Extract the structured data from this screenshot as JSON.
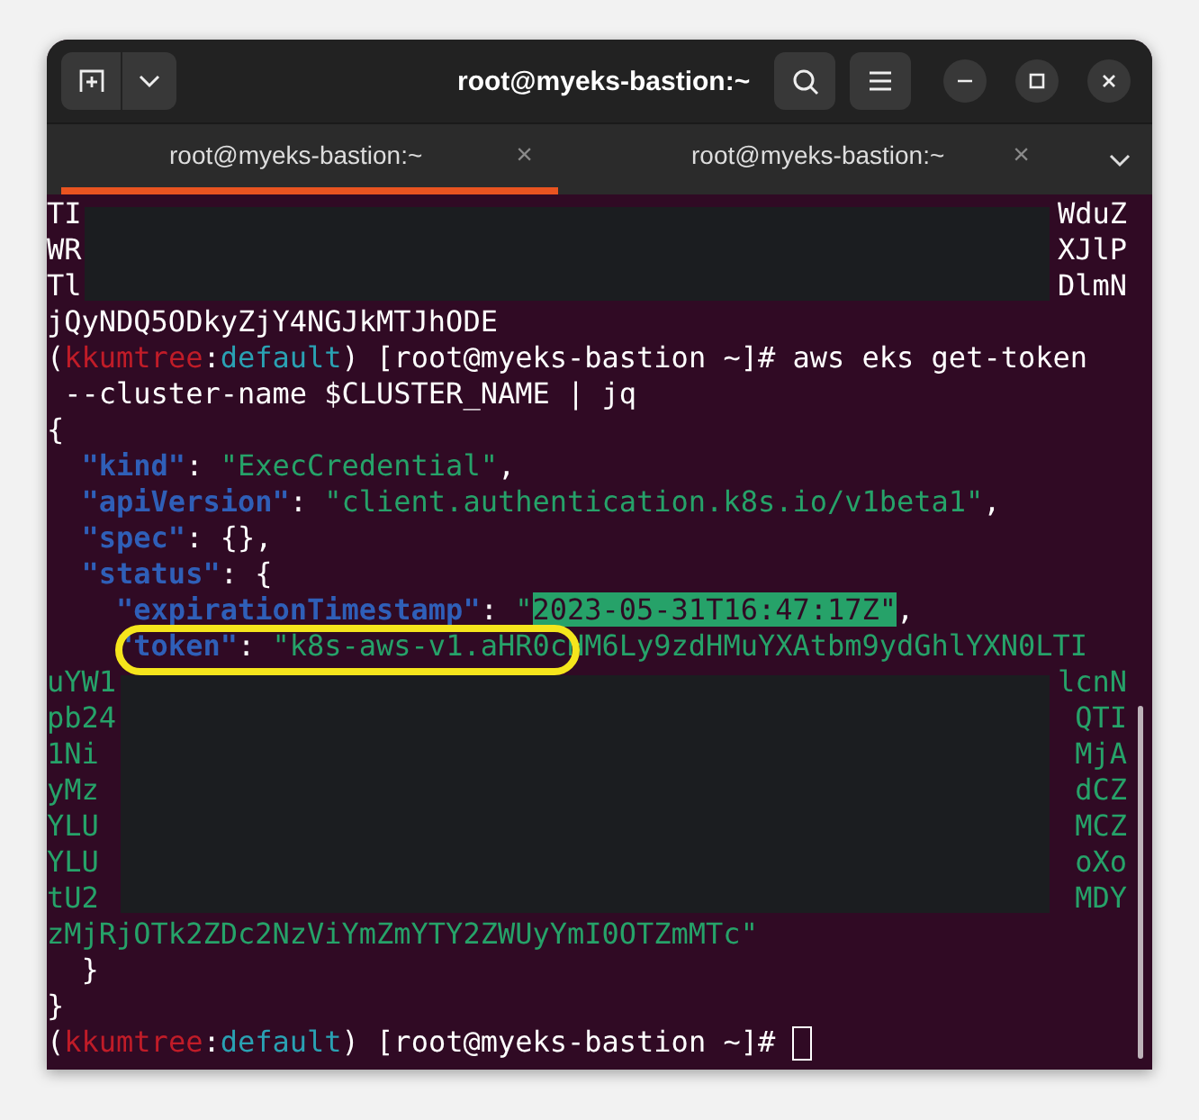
{
  "window": {
    "title": "root@myeks-bastion:~"
  },
  "tabs": [
    {
      "label": "root@myeks-bastion:~",
      "close": "×",
      "selected": true
    },
    {
      "label": "root@myeks-bastion:~",
      "close": "×",
      "selected": false
    }
  ],
  "terminal": {
    "lines": [
      {
        "kind": "masked",
        "rows": [
          {
            "kind": "plain",
            "left": "TI",
            "right": "WduZ"
          },
          {
            "kind": "plain",
            "left": "WR",
            "right": "XJlP"
          },
          {
            "kind": "plain",
            "left": "Tl",
            "right": "DlmN"
          }
        ]
      },
      {
        "kind": "text",
        "segments": [
          {
            "text": "jQyNDQ5ODkyZjY4NGJkMTJhODE",
            "kind": "plain"
          }
        ]
      },
      {
        "kind": "text",
        "segments": [
          {
            "text": "(",
            "kind": "plain"
          },
          {
            "text": "kkumtree",
            "kind": "context"
          },
          {
            "text": ":",
            "kind": "plain"
          },
          {
            "text": "default",
            "kind": "namespace"
          },
          {
            "text": ") [root@myeks-bastion ~]# aws eks get-token",
            "kind": "plain"
          }
        ]
      },
      {
        "kind": "text",
        "segments": [
          {
            "text": " --cluster-name $CLUSTER_NAME | jq",
            "kind": "plain"
          }
        ]
      },
      {
        "kind": "text",
        "segments": [
          {
            "text": "{",
            "kind": "punct"
          }
        ]
      },
      {
        "kind": "text",
        "segments": [
          {
            "text": "  \"kind\"",
            "kind": "key"
          },
          {
            "text": ": ",
            "kind": "punct"
          },
          {
            "text": "\"ExecCredential\"",
            "kind": "string"
          },
          {
            "text": ",",
            "kind": "punct"
          }
        ]
      },
      {
        "kind": "text",
        "segments": [
          {
            "text": "  \"apiVersion\"",
            "kind": "key"
          },
          {
            "text": ": ",
            "kind": "punct"
          },
          {
            "text": "\"client.authentication.k8s.io/v1beta1\"",
            "kind": "string"
          },
          {
            "text": ",",
            "kind": "punct"
          }
        ]
      },
      {
        "kind": "text",
        "segments": [
          {
            "text": "  \"spec\"",
            "kind": "key"
          },
          {
            "text": ": {},",
            "kind": "punct"
          }
        ]
      },
      {
        "kind": "text",
        "segments": [
          {
            "text": "  \"status\"",
            "kind": "key"
          },
          {
            "text": ": {",
            "kind": "punct"
          }
        ]
      },
      {
        "kind": "text",
        "segments": [
          {
            "text": "    \"expirationTimestamp\"",
            "kind": "key"
          },
          {
            "text": ": ",
            "kind": "punct"
          },
          {
            "text": "\"",
            "kind": "string"
          },
          {
            "text": "2023-05-31T16:47:17Z\"",
            "kind": "highlight"
          },
          {
            "text": ",",
            "kind": "punct"
          }
        ]
      },
      {
        "kind": "text",
        "circled": true,
        "segments": [
          {
            "text": "    \"token\"",
            "kind": "key"
          },
          {
            "text": ": ",
            "kind": "punct"
          },
          {
            "text": "\"k8s-aws-v1.aHR0cHM6Ly9zdHMuYXAtbm9ydGhlYXN0LTI",
            "kind": "string"
          }
        ]
      },
      {
        "kind": "masked",
        "rows": [
          {
            "kind": "string",
            "left": "uYW1",
            "right": "lcnN"
          },
          {
            "kind": "string",
            "left": "pb24",
            "right": "QTI"
          },
          {
            "kind": "string",
            "left": "1Ni",
            "right": "MjA"
          },
          {
            "kind": "string",
            "left": "yMz",
            "right": "dCZ"
          },
          {
            "kind": "string",
            "left": "YLU",
            "right": "MCZ"
          },
          {
            "kind": "string",
            "left": "YLU",
            "right": "oXo"
          },
          {
            "kind": "string",
            "left": "tU2",
            "right": "MDY"
          }
        ]
      },
      {
        "kind": "text",
        "segments": [
          {
            "text": "zMjRjOTk2ZDc2NzViYmZmYTY2ZWUyYmI0OTZmMTc\"",
            "kind": "string"
          }
        ]
      },
      {
        "kind": "text",
        "segments": [
          {
            "text": "  }",
            "kind": "punct"
          }
        ]
      },
      {
        "kind": "text",
        "segments": [
          {
            "text": "}",
            "kind": "punct"
          }
        ]
      },
      {
        "kind": "text",
        "cursor": true,
        "segments": [
          {
            "text": "(",
            "kind": "plain"
          },
          {
            "text": "kkumtree",
            "kind": "context"
          },
          {
            "text": ":",
            "kind": "plain"
          },
          {
            "text": "default",
            "kind": "namespace"
          },
          {
            "text": ") [root@myeks-bastion ~]# ",
            "kind": "plain"
          }
        ]
      }
    ]
  }
}
